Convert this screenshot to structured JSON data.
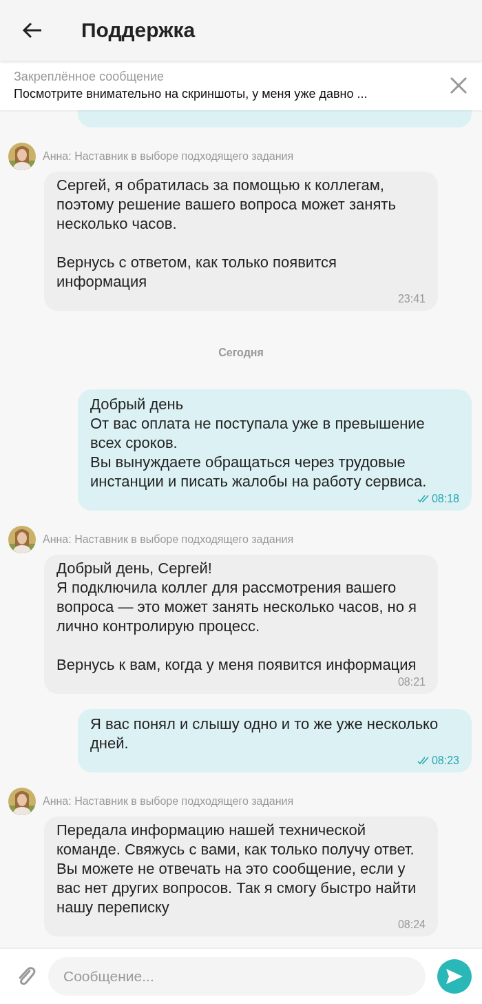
{
  "header": {
    "title": "Поддержка"
  },
  "pinned": {
    "label": "Закреплённое сообщение",
    "text": "Посмотрите внимательно на скриншоты, у меня уже давно ..."
  },
  "messages": [
    {
      "kind": "cut_off"
    },
    {
      "kind": "incoming",
      "sender": "Анна: Наставник в выборе подходящего задания",
      "text": "Сергей, я обратилась за помощью к коллегам, поэтому решение вашего вопроса может занять несколько часов.\n\nВернусь с ответом, как только появится информация",
      "time": "23:41"
    },
    {
      "kind": "date",
      "text": "Сегодня"
    },
    {
      "kind": "outgoing",
      "text": "Добрый день\nОт вас оплата не поступала уже в превышение всех сроков.\nВы вынуждаете обращаться через трудовые инстанции и писать жалобы на работу сервиса.",
      "time": "08:18"
    },
    {
      "kind": "incoming",
      "sender": "Анна: Наставник в выборе подходящего задания",
      "text": "Добрый день, Сергей!\nЯ подключила коллег для рассмотрения вашего вопроса — это может занять несколько часов, но я лично контролирую процесс.\n\nВернусь к вам, когда у меня появится информация",
      "time": "08:21"
    },
    {
      "kind": "outgoing",
      "text": "Я вас понял и слышу одно и то же уже несколько дней.",
      "time": "08:23"
    },
    {
      "kind": "incoming",
      "sender": "Анна: Наставник в выборе подходящего задания",
      "text": "Передала информацию нашей технической команде. Свяжусь с вами, как только получу ответ.\nВы можете не отвечать на это сообщение, если у вас нет других вопросов. Так я смогу быстро найти нашу переписку",
      "time": "08:24"
    }
  ],
  "composer": {
    "placeholder": "Сообщение..."
  }
}
